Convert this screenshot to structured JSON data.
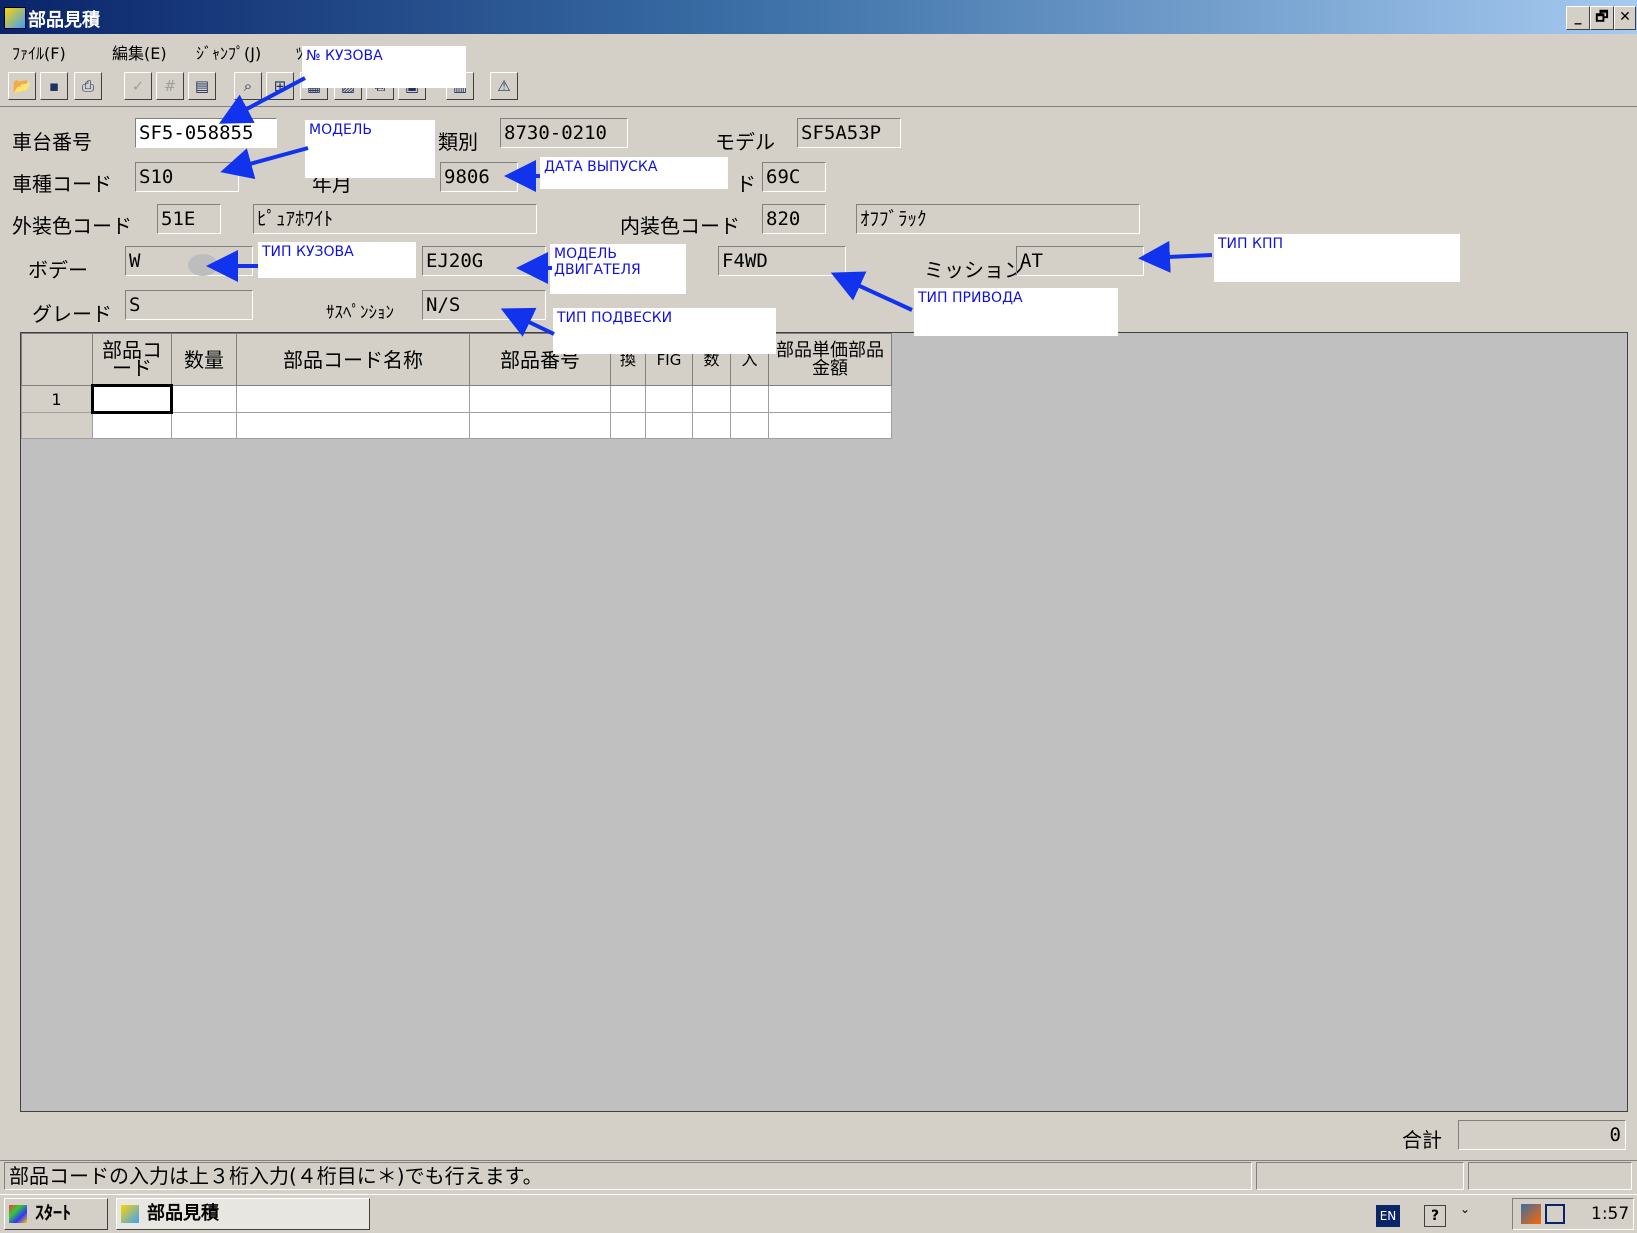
{
  "window": {
    "title": "部品見積",
    "minimize": "_",
    "restore": "🗗",
    "close": "✕"
  },
  "menu": [
    "ﾌｧｲﾙ(F)",
    "編集(E)",
    "ｼﾞｬﾝﾌﾟ(J)",
    "ﾂ"
  ],
  "toolbar_icons": [
    "open-icon",
    "save-icon",
    "print-icon",
    "numbers-icon",
    "code-icon",
    "export-icon",
    "lookup-icon",
    "table-icon",
    "image-icon",
    "car-icon",
    "window-icon",
    "chart-icon",
    "calculator-icon",
    "report-icon"
  ],
  "form": {
    "chassis_label": "車台番号",
    "chassis_value": "SF5-058855",
    "class_label": "類別",
    "class_value": "8730-0210",
    "model_label": "モデル",
    "model_value": "SF5A53P",
    "type_code_label": "車種コード",
    "type_code_value": "S10",
    "date_label": "年月",
    "date_value": "9806",
    "code_label_partial": "ド",
    "code_value": "69C",
    "ext_color_label": "外装色コード",
    "ext_color_code": "51E",
    "ext_color_name": "ﾋﾟｭｱﾎﾜｲﾄ",
    "int_color_label": "内装色コード",
    "int_color_code": "820",
    "int_color_name": "ｵﾌﾌﾞﾗｯｸ",
    "body_label": "ボデー",
    "body_value": "W",
    "engine_value": "EJ20G",
    "drive_value": "F4WD",
    "mission_label": "ミッション",
    "mission_value": "AT",
    "grade_label": "グレード",
    "grade_value": "S",
    "suspension_label": "ｻｽﾍﾟﾝｼｮﾝ",
    "suspension_value": "N/S"
  },
  "annotations": {
    "body_number": "№ КУЗОВА",
    "model": "МОДЕЛЬ",
    "release_date": "ДАТА ВЫПУСКА",
    "body_type": "ТИП КУЗОВА",
    "engine_model": "МОДЕЛЬ ДВИГАТЕЛЯ",
    "gearbox_type": "ТИП КПП",
    "drive_type": "ТИП ПРИВОДА",
    "suspension_type": "ТИП ПОДВЕСКИ"
  },
  "table": {
    "headers": [
      "",
      "部品コード",
      "数量",
      "部品コード名称",
      "部品番号",
      "換",
      "FIG",
      "数",
      "入",
      "部品単価部品金額"
    ],
    "rows": [
      [
        "1"
      ],
      [
        ""
      ]
    ]
  },
  "total": {
    "label": "合計",
    "value": "0"
  },
  "status": {
    "message": "部品コードの入力は上３桁入力(４桁目に＊)でも行えます。"
  },
  "taskbar": {
    "start": "ｽﾀｰﾄ",
    "app": "部品見積",
    "lang": "EN",
    "time": "1:57"
  }
}
